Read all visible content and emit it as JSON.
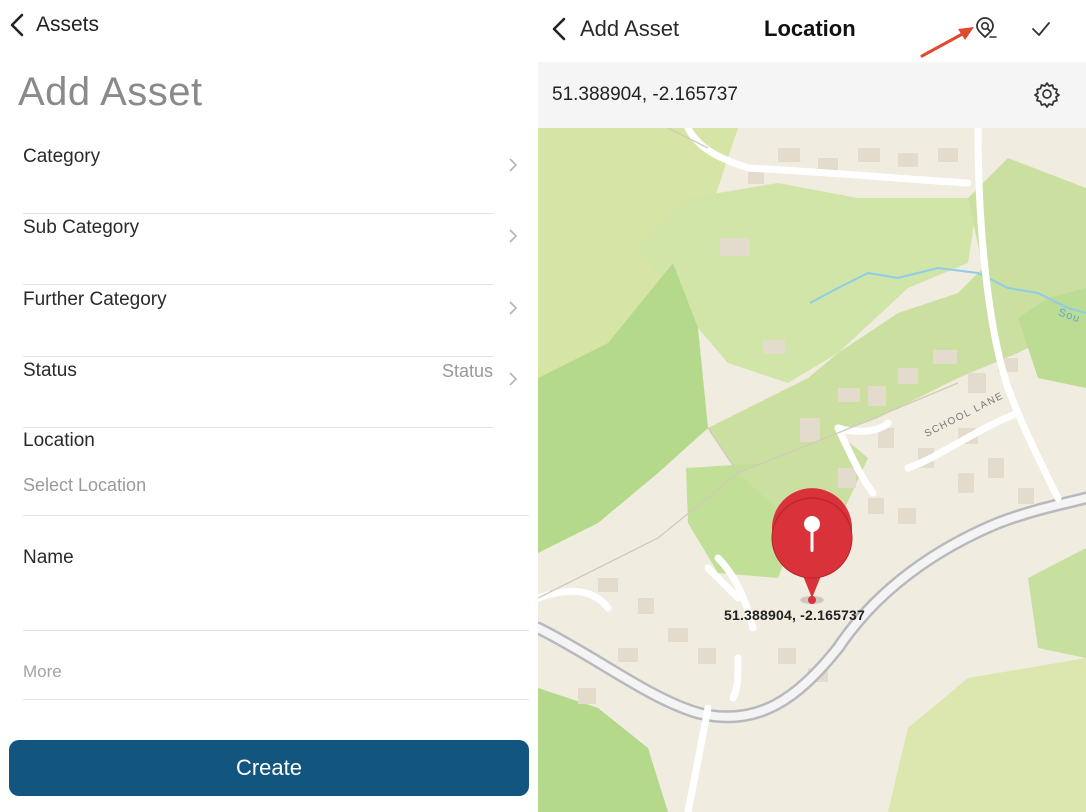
{
  "left": {
    "back_label": "Assets",
    "title": "Add Asset",
    "fields": [
      {
        "label": "Category",
        "value": ""
      },
      {
        "label": "Sub Category",
        "value": ""
      },
      {
        "label": "Further Category",
        "value": ""
      },
      {
        "label": "Status",
        "value": "Status"
      }
    ],
    "location": {
      "label": "Location",
      "placeholder": "Select Location"
    },
    "name": {
      "label": "Name",
      "value": ""
    },
    "more_label": "More",
    "create_label": "Create",
    "create_color": "#12557f"
  },
  "right": {
    "back_label": "Add Asset",
    "title": "Location",
    "icons": {
      "search": "location-search-icon",
      "confirm": "checkmark-icon",
      "settings": "gear-icon"
    },
    "coordinates": "51.388904, -2.165737",
    "map": {
      "pin_label": "51.388904, -2.165737",
      "street_label": "SCHOOL LANE",
      "river_label": "Sou",
      "pin_color": "#d9323a",
      "annotation_arrow_color": "#e04a2e"
    }
  }
}
